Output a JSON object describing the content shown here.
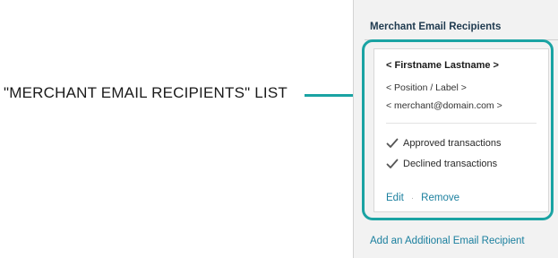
{
  "callout": {
    "label": "\"MERCHANT EMAIL RECIPIENTS\" LIST",
    "color": "#1aa3a3"
  },
  "panel": {
    "title": "Merchant Email Recipients",
    "add_link": "Add an Additional Email Recipient"
  },
  "recipient": {
    "name": "< Firstname Lastname >",
    "position": "< Position / Label >",
    "email": "< merchant@domain.com >",
    "notifications": [
      {
        "label": "Approved transactions",
        "icon": "checkmark-icon"
      },
      {
        "label": "Declined transactions",
        "icon": "checkmark-icon"
      }
    ],
    "actions": {
      "edit": "Edit",
      "separator": "·",
      "remove": "Remove"
    }
  },
  "colors": {
    "accent": "#1aa3a3",
    "link": "#1a7f9e",
    "panel_bg": "#f2f2f2"
  }
}
